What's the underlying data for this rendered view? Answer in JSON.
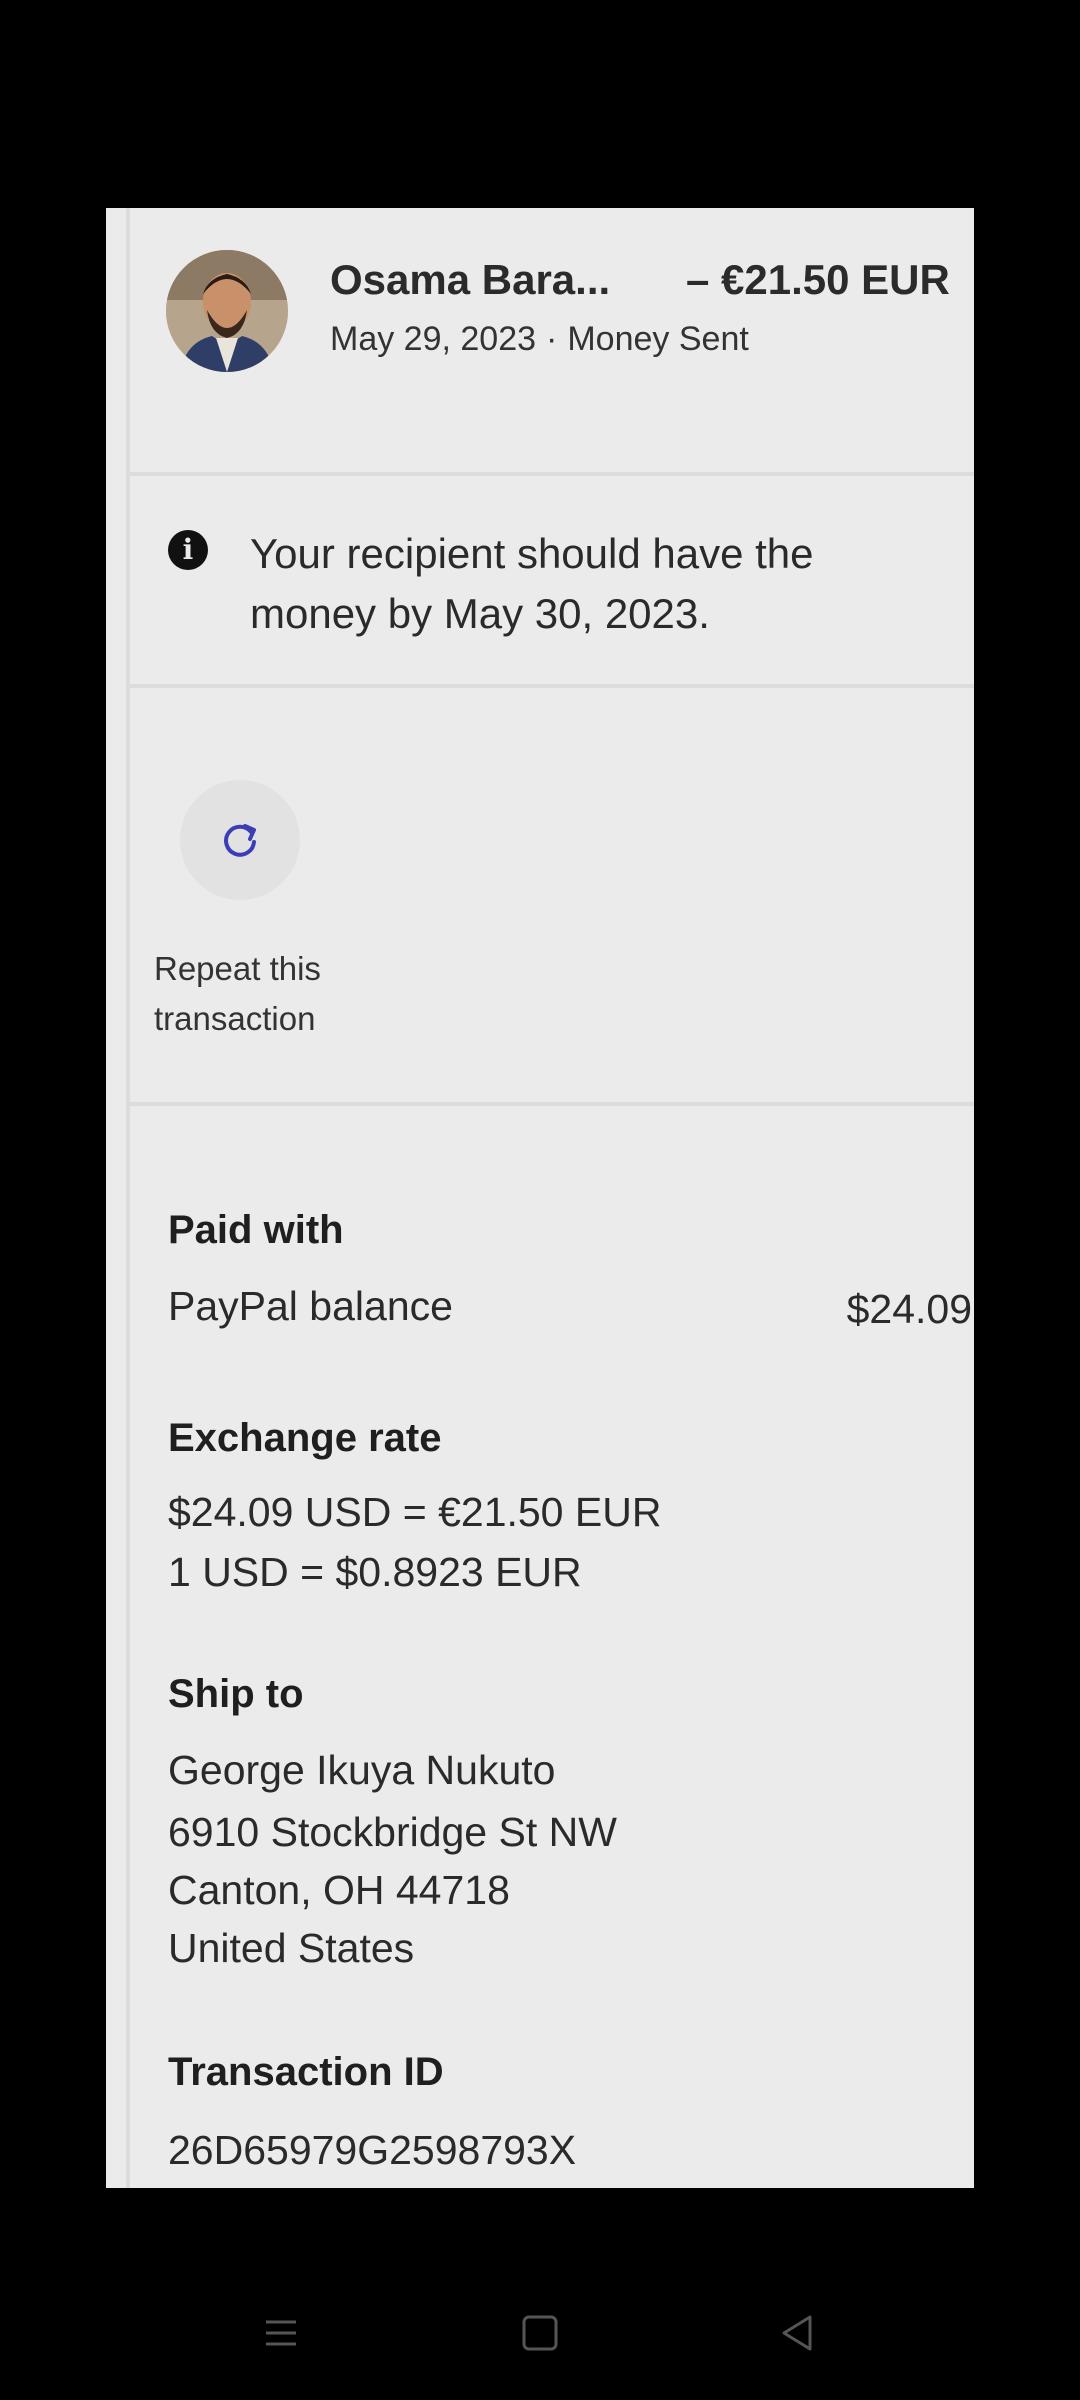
{
  "transaction": {
    "recipient_name": "Osama Bara...",
    "amount": "– €21.50 EUR",
    "date": "May 29, 2023",
    "separator": "·",
    "type": "Money Sent"
  },
  "info_banner": {
    "icon": "info-icon",
    "text": "Your recipient should have the money by May 30, 2023."
  },
  "actions": {
    "repeat_icon": "refresh-icon",
    "repeat_label": "Repeat this transaction",
    "accent_color": "#3b3fb6"
  },
  "details": {
    "paid_with": {
      "heading": "Paid with",
      "method": "PayPal balance",
      "amount": "$24.09"
    },
    "exchange_rate": {
      "heading": "Exchange rate",
      "line1": "$24.09 USD = €21.50 EUR",
      "line2": "1 USD = $0.8923 EUR"
    },
    "ship_to": {
      "heading": "Ship to",
      "name": "George Ikuya Nukuto",
      "street": "6910 Stockbridge St NW",
      "city": "Canton, OH 44718",
      "country": "United States"
    },
    "transaction_id": {
      "heading": "Transaction ID",
      "value": "26D65979G2598793X"
    }
  },
  "system_nav": {
    "menu_icon": "menu-icon",
    "home_icon": "home-square-icon",
    "back_icon": "back-triangle-icon"
  }
}
